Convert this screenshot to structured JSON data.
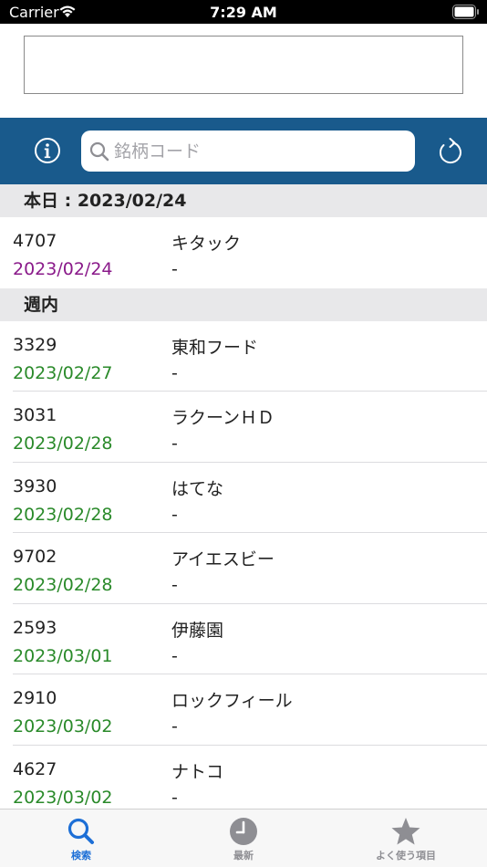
{
  "status_bar": {
    "carrier": "Carrier",
    "time": "7:29 AM"
  },
  "search": {
    "placeholder": "銘柄コード"
  },
  "sections": [
    {
      "header": "本日 : 2023/02/24",
      "rows": [
        {
          "code": "4707",
          "date": "2023/02/24",
          "name": "キタック",
          "sub": "-"
        }
      ]
    },
    {
      "header": "週内",
      "rows": [
        {
          "code": "3329",
          "date": "2023/02/27",
          "name": "東和フード",
          "sub": "-"
        },
        {
          "code": "3031",
          "date": "2023/02/28",
          "name": "ラクーンＨＤ",
          "sub": "-"
        },
        {
          "code": "3930",
          "date": "2023/02/28",
          "name": "はてな",
          "sub": "-"
        },
        {
          "code": "9702",
          "date": "2023/02/28",
          "name": "アイエスビー",
          "sub": "-"
        },
        {
          "code": "2593",
          "date": "2023/03/01",
          "name": "伊藤園",
          "sub": "-"
        },
        {
          "code": "2910",
          "date": "2023/03/02",
          "name": "ロックフィール",
          "sub": "-"
        },
        {
          "code": "4627",
          "date": "2023/03/02",
          "name": "ナトコ",
          "sub": "-"
        }
      ]
    }
  ],
  "tabs": [
    {
      "label": "検索",
      "icon": "search-icon",
      "active": true
    },
    {
      "label": "最新",
      "icon": "clock-icon",
      "active": false
    },
    {
      "label": "よく使う項目",
      "icon": "star-icon",
      "active": false
    }
  ],
  "colors": {
    "header_bar": "#195a8c",
    "today_date": "#8a1a8a",
    "week_date": "#2a8a2a",
    "active_tab": "#1d6fd6",
    "inactive_tab": "#8e8e93"
  }
}
